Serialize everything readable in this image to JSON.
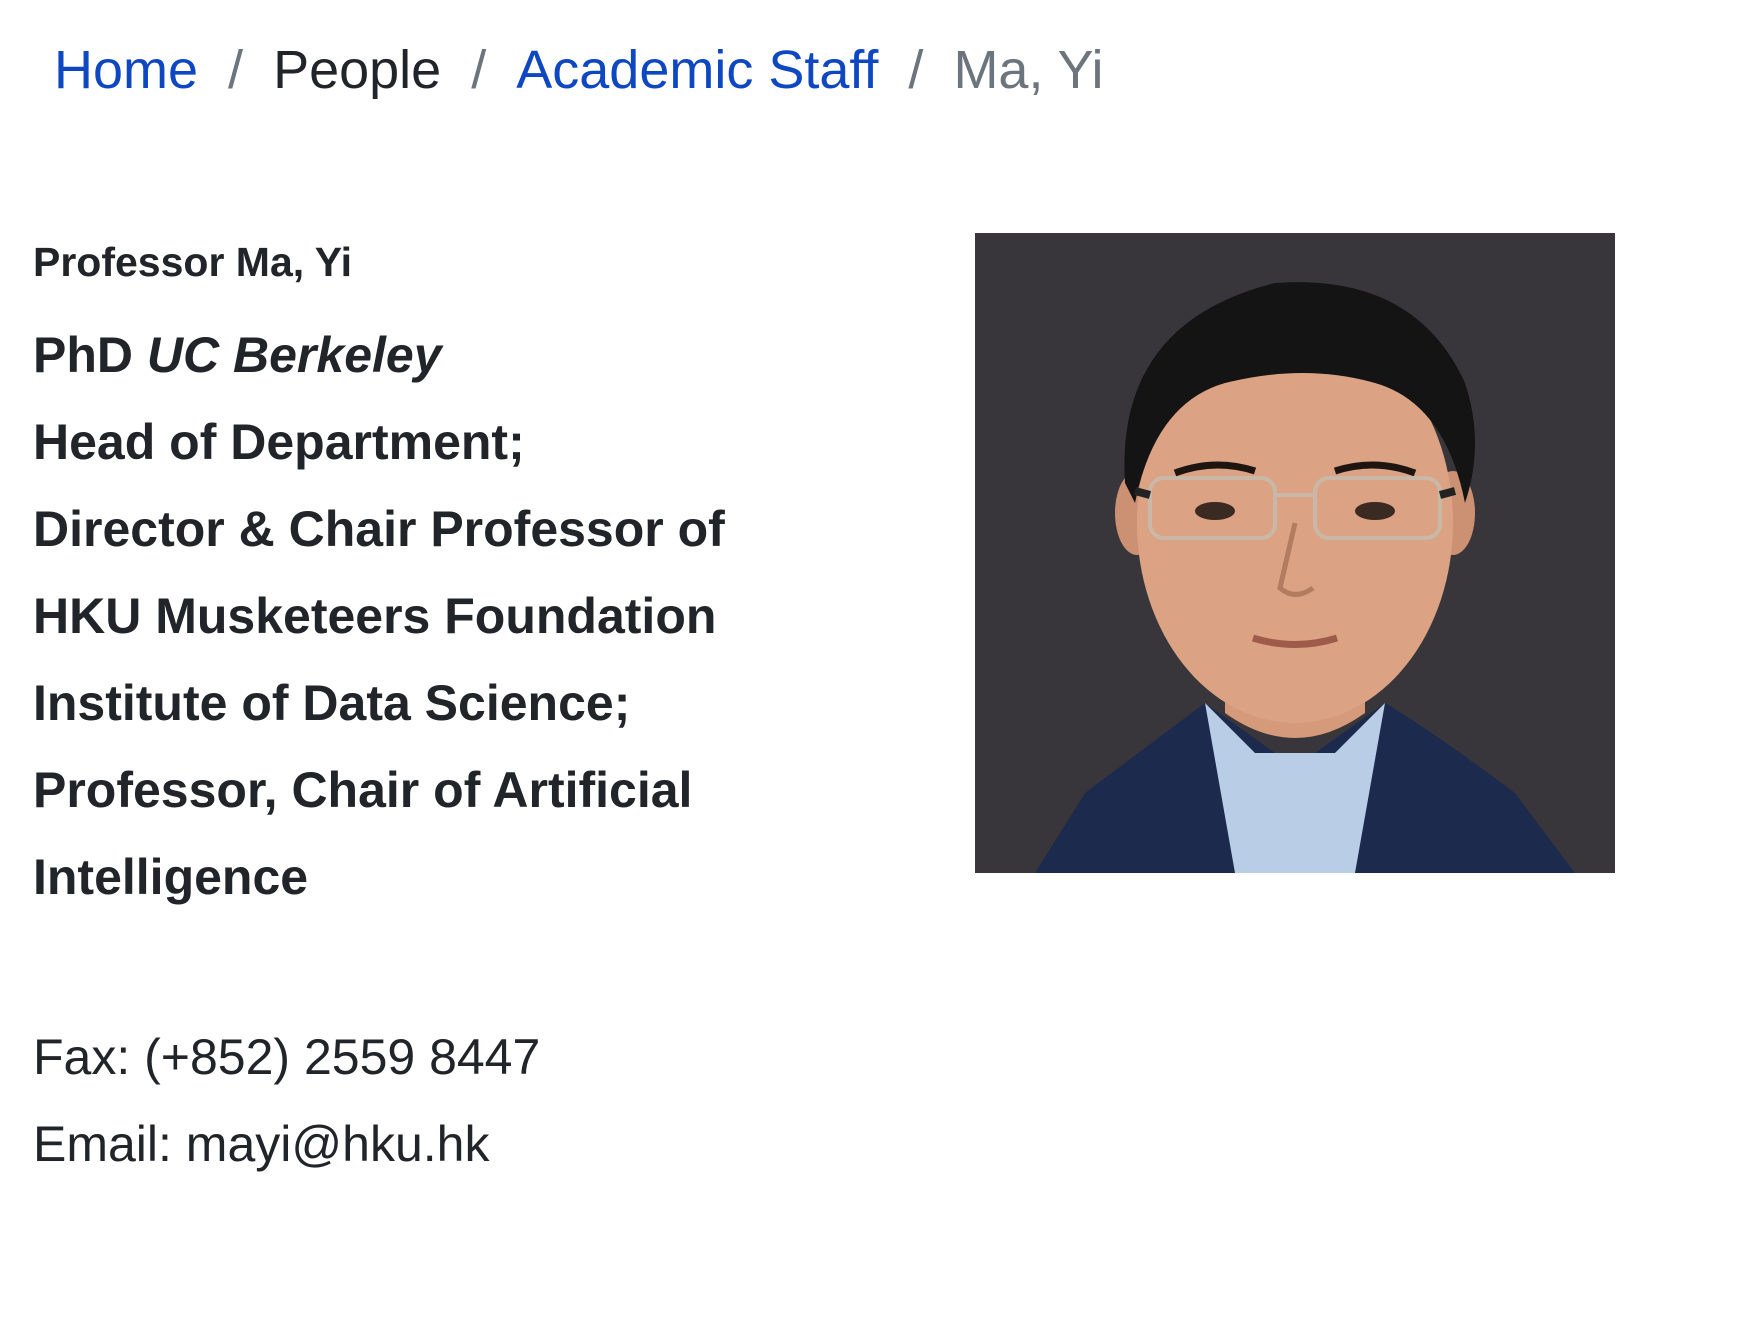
{
  "breadcrumb": {
    "home": "Home",
    "separator": "/",
    "people": "People",
    "academic_staff": "Academic Staff",
    "current": "Ma, Yi"
  },
  "profile": {
    "name": "Professor Ma, Yi",
    "degree_prefix": "PhD ",
    "degree_school": "UC Berkeley",
    "title_lines": [
      "Head of Department;",
      "Director & Chair Professor of",
      "HKU Musketeers Foundation",
      "Institute of Data Science;",
      "Professor, Chair of Artificial",
      "Intelligence"
    ]
  },
  "contact": {
    "fax": "Fax: (+852) 2559 8447",
    "email": "Email: mayi@hku.hk"
  },
  "colors": {
    "link": "#0d47c1",
    "text": "#212529",
    "muted": "#6c757d",
    "photo_background": "#38363b"
  }
}
